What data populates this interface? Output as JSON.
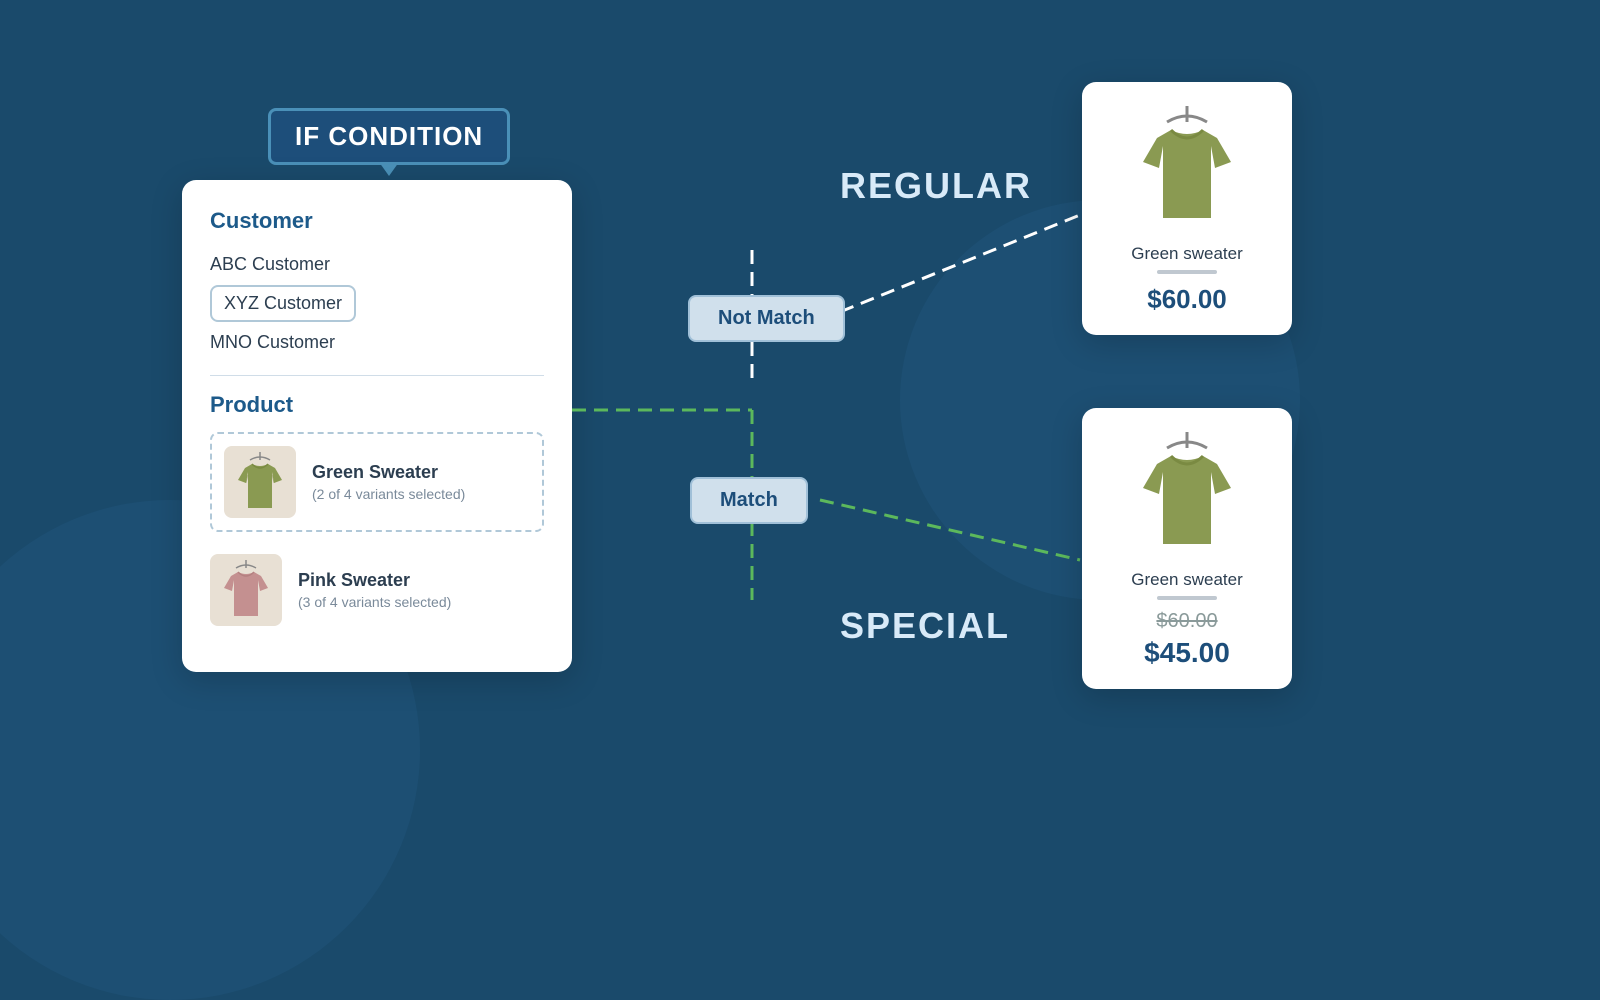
{
  "condition_label": "IF CONDITION",
  "condition_panel": {
    "customer_section": {
      "title": "Customer",
      "items": [
        {
          "name": "ABC Customer",
          "selected": false
        },
        {
          "name": "XYZ Customer",
          "selected": true
        },
        {
          "name": "MNO Customer",
          "selected": false
        }
      ]
    },
    "product_section": {
      "title": "Product",
      "items": [
        {
          "name": "Green Sweater",
          "variants": "(2 of 4 variants selected)",
          "type": "green",
          "selected": true
        },
        {
          "name": "Pink Sweater",
          "variants": "(3 of 4 variants selected)",
          "type": "pink",
          "selected": false
        }
      ]
    }
  },
  "flow": {
    "not_match_label": "Not Match",
    "match_label": "Match",
    "regular_label": "REGULAR",
    "special_label": "SPECIAL"
  },
  "cards": {
    "regular": {
      "name": "Green sweater",
      "price": "$60.00"
    },
    "special": {
      "name": "Green sweater",
      "price_original": "$60.00",
      "price_special": "$45.00"
    }
  }
}
